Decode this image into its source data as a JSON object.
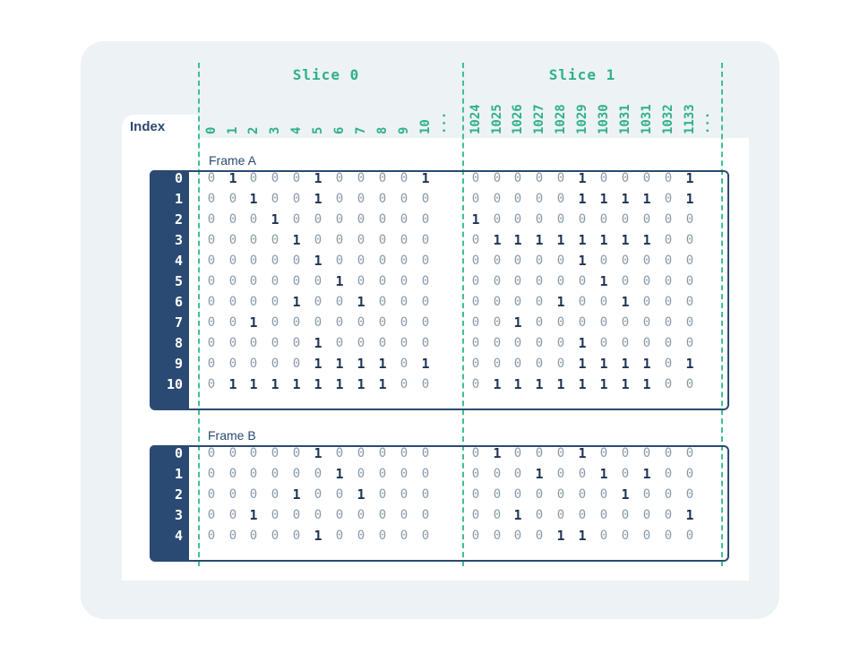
{
  "index_label": "Index",
  "slices": [
    {
      "title": "Slice 0",
      "columns": [
        "0",
        "1",
        "2",
        "3",
        "4",
        "5",
        "6",
        "7",
        "8",
        "9",
        "10",
        "..."
      ]
    },
    {
      "title": "Slice 1",
      "columns": [
        "1024",
        "1025",
        "1026",
        "1027",
        "1028",
        "1029",
        "1030",
        "1031",
        "1031",
        "1032",
        "1133",
        "..."
      ]
    }
  ],
  "frames": [
    {
      "label": "Frame A",
      "row_indices": [
        "0",
        "1",
        "2",
        "3",
        "4",
        "5",
        "6",
        "7",
        "8",
        "9",
        "10"
      ],
      "slice0": [
        "01000100001",
        "00100100000",
        "00010000000",
        "00001000000",
        "00000100000",
        "00000010000",
        "00001001000",
        "00100000000",
        "00000100000",
        "00000111101",
        "01111111100"
      ],
      "slice1": [
        "00000100001",
        "00000111101",
        "10000000000",
        "01111111100",
        "00000100000",
        "00000010000",
        "00001001000",
        "00100000000",
        "00000100000",
        "00000111101",
        "01111111100"
      ]
    },
    {
      "label": "Frame B",
      "row_indices": [
        "0",
        "1",
        "2",
        "3",
        "4"
      ],
      "slice0": [
        "00000100000",
        "00000010000",
        "00001001000",
        "00100000000",
        "00000100000"
      ],
      "slice1": [
        "01000100000",
        "00010010100",
        "00000001000",
        "00100000001",
        "00001100000"
      ]
    }
  ]
}
